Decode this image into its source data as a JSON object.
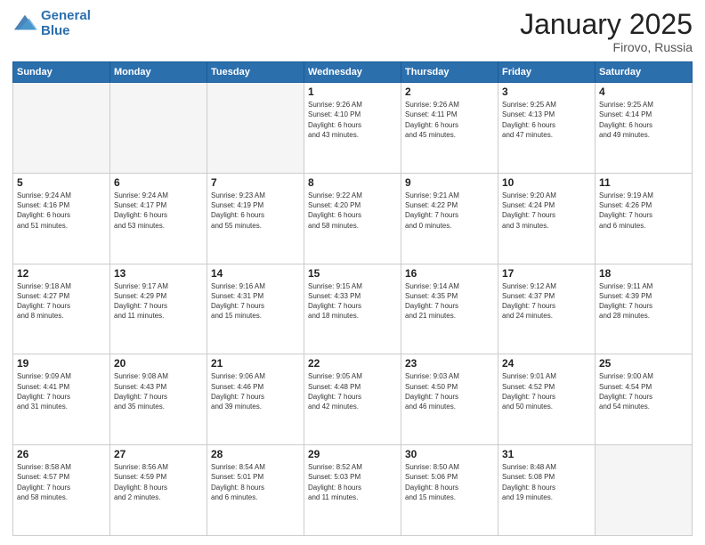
{
  "logo": {
    "line1": "General",
    "line2": "Blue"
  },
  "header": {
    "month": "January 2025",
    "location": "Firovo, Russia"
  },
  "days_of_week": [
    "Sunday",
    "Monday",
    "Tuesday",
    "Wednesday",
    "Thursday",
    "Friday",
    "Saturday"
  ],
  "weeks": [
    [
      {
        "day": "",
        "info": ""
      },
      {
        "day": "",
        "info": ""
      },
      {
        "day": "",
        "info": ""
      },
      {
        "day": "1",
        "info": "Sunrise: 9:26 AM\nSunset: 4:10 PM\nDaylight: 6 hours\nand 43 minutes."
      },
      {
        "day": "2",
        "info": "Sunrise: 9:26 AM\nSunset: 4:11 PM\nDaylight: 6 hours\nand 45 minutes."
      },
      {
        "day": "3",
        "info": "Sunrise: 9:25 AM\nSunset: 4:13 PM\nDaylight: 6 hours\nand 47 minutes."
      },
      {
        "day": "4",
        "info": "Sunrise: 9:25 AM\nSunset: 4:14 PM\nDaylight: 6 hours\nand 49 minutes."
      }
    ],
    [
      {
        "day": "5",
        "info": "Sunrise: 9:24 AM\nSunset: 4:16 PM\nDaylight: 6 hours\nand 51 minutes."
      },
      {
        "day": "6",
        "info": "Sunrise: 9:24 AM\nSunset: 4:17 PM\nDaylight: 6 hours\nand 53 minutes."
      },
      {
        "day": "7",
        "info": "Sunrise: 9:23 AM\nSunset: 4:19 PM\nDaylight: 6 hours\nand 55 minutes."
      },
      {
        "day": "8",
        "info": "Sunrise: 9:22 AM\nSunset: 4:20 PM\nDaylight: 6 hours\nand 58 minutes."
      },
      {
        "day": "9",
        "info": "Sunrise: 9:21 AM\nSunset: 4:22 PM\nDaylight: 7 hours\nand 0 minutes."
      },
      {
        "day": "10",
        "info": "Sunrise: 9:20 AM\nSunset: 4:24 PM\nDaylight: 7 hours\nand 3 minutes."
      },
      {
        "day": "11",
        "info": "Sunrise: 9:19 AM\nSunset: 4:26 PM\nDaylight: 7 hours\nand 6 minutes."
      }
    ],
    [
      {
        "day": "12",
        "info": "Sunrise: 9:18 AM\nSunset: 4:27 PM\nDaylight: 7 hours\nand 8 minutes."
      },
      {
        "day": "13",
        "info": "Sunrise: 9:17 AM\nSunset: 4:29 PM\nDaylight: 7 hours\nand 11 minutes."
      },
      {
        "day": "14",
        "info": "Sunrise: 9:16 AM\nSunset: 4:31 PM\nDaylight: 7 hours\nand 15 minutes."
      },
      {
        "day": "15",
        "info": "Sunrise: 9:15 AM\nSunset: 4:33 PM\nDaylight: 7 hours\nand 18 minutes."
      },
      {
        "day": "16",
        "info": "Sunrise: 9:14 AM\nSunset: 4:35 PM\nDaylight: 7 hours\nand 21 minutes."
      },
      {
        "day": "17",
        "info": "Sunrise: 9:12 AM\nSunset: 4:37 PM\nDaylight: 7 hours\nand 24 minutes."
      },
      {
        "day": "18",
        "info": "Sunrise: 9:11 AM\nSunset: 4:39 PM\nDaylight: 7 hours\nand 28 minutes."
      }
    ],
    [
      {
        "day": "19",
        "info": "Sunrise: 9:09 AM\nSunset: 4:41 PM\nDaylight: 7 hours\nand 31 minutes."
      },
      {
        "day": "20",
        "info": "Sunrise: 9:08 AM\nSunset: 4:43 PM\nDaylight: 7 hours\nand 35 minutes."
      },
      {
        "day": "21",
        "info": "Sunrise: 9:06 AM\nSunset: 4:46 PM\nDaylight: 7 hours\nand 39 minutes."
      },
      {
        "day": "22",
        "info": "Sunrise: 9:05 AM\nSunset: 4:48 PM\nDaylight: 7 hours\nand 42 minutes."
      },
      {
        "day": "23",
        "info": "Sunrise: 9:03 AM\nSunset: 4:50 PM\nDaylight: 7 hours\nand 46 minutes."
      },
      {
        "day": "24",
        "info": "Sunrise: 9:01 AM\nSunset: 4:52 PM\nDaylight: 7 hours\nand 50 minutes."
      },
      {
        "day": "25",
        "info": "Sunrise: 9:00 AM\nSunset: 4:54 PM\nDaylight: 7 hours\nand 54 minutes."
      }
    ],
    [
      {
        "day": "26",
        "info": "Sunrise: 8:58 AM\nSunset: 4:57 PM\nDaylight: 7 hours\nand 58 minutes."
      },
      {
        "day": "27",
        "info": "Sunrise: 8:56 AM\nSunset: 4:59 PM\nDaylight: 8 hours\nand 2 minutes."
      },
      {
        "day": "28",
        "info": "Sunrise: 8:54 AM\nSunset: 5:01 PM\nDaylight: 8 hours\nand 6 minutes."
      },
      {
        "day": "29",
        "info": "Sunrise: 8:52 AM\nSunset: 5:03 PM\nDaylight: 8 hours\nand 11 minutes."
      },
      {
        "day": "30",
        "info": "Sunrise: 8:50 AM\nSunset: 5:06 PM\nDaylight: 8 hours\nand 15 minutes."
      },
      {
        "day": "31",
        "info": "Sunrise: 8:48 AM\nSunset: 5:08 PM\nDaylight: 8 hours\nand 19 minutes."
      },
      {
        "day": "",
        "info": ""
      }
    ]
  ]
}
